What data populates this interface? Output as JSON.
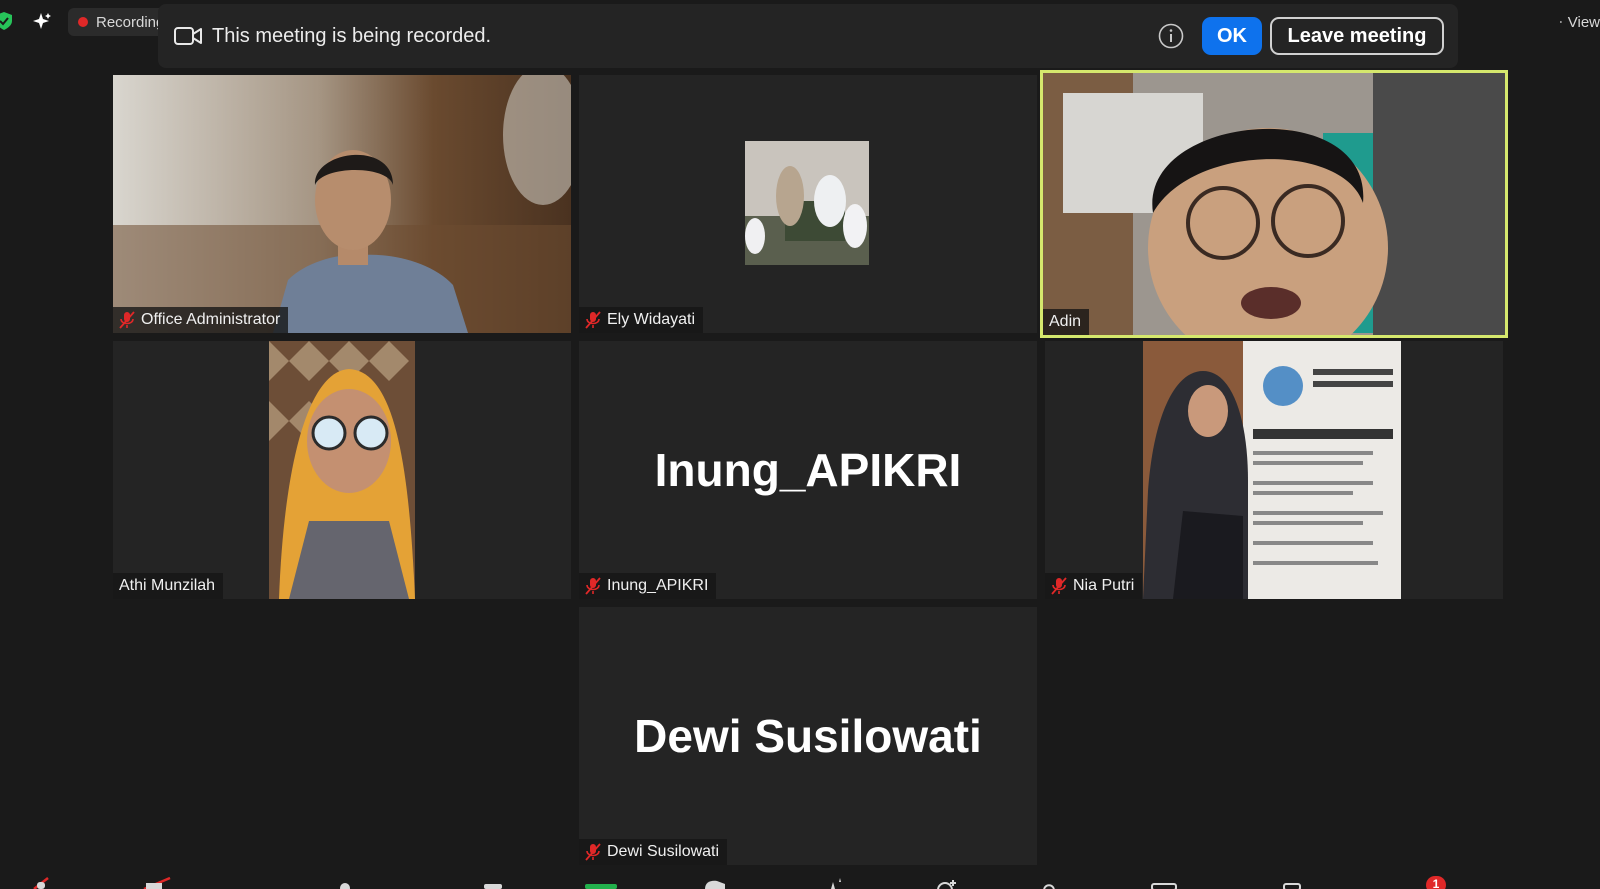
{
  "recording_indicator": {
    "label": "Recording"
  },
  "view_button": {
    "label": "View"
  },
  "banner": {
    "message": "This meeting is being recorded.",
    "ok_label": "OK",
    "leave_label": "Leave meeting"
  },
  "participants": [
    {
      "name": "Office Administrator",
      "muted": true,
      "video": "camera"
    },
    {
      "name": "Ely Widayati",
      "muted": true,
      "video": "small-picture"
    },
    {
      "name": "Adin",
      "muted": false,
      "video": "camera",
      "active_speaker": true
    },
    {
      "name": "Athi Munzilah",
      "muted": false,
      "video": "camera-narrow"
    },
    {
      "name": "Inung_APIKRI",
      "muted": true,
      "video": "off",
      "display_name": "Inung_APIKRI"
    },
    {
      "name": "Nia Putri",
      "muted": true,
      "video": "camera-narrow"
    },
    {
      "name": "Dewi Susilowati",
      "muted": true,
      "video": "off",
      "display_name": "Dewi Susilowati"
    }
  ],
  "toolbar": {
    "notification_count": "1"
  },
  "colors": {
    "background": "#1a1a1a",
    "tile": "#242424",
    "active_speaker_border": "#d5e86d",
    "ok_blue": "#0e72ed",
    "mute_red": "#e02828"
  }
}
